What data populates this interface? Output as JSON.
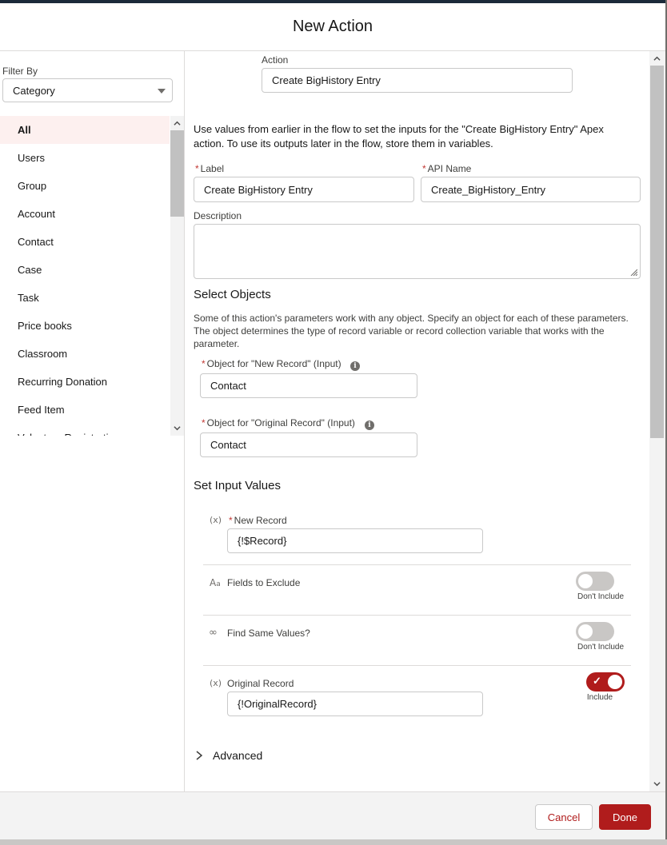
{
  "modal": {
    "title": "New Action"
  },
  "filter": {
    "label": "Filter By",
    "selected": "Category"
  },
  "categories": [
    "All",
    "Users",
    "Group",
    "Account",
    "Contact",
    "Case",
    "Task",
    "Price books",
    "Classroom",
    "Recurring Donation",
    "Feed Item",
    "Volunteer Registration"
  ],
  "action": {
    "label": "Action",
    "value": "Create BigHistory Entry"
  },
  "intro_text": "Use values from earlier in the flow to set the inputs for the \"Create BigHistory Entry\" Apex action. To use its outputs later in the flow, store them in variables.",
  "fields": {
    "label_label": "Label",
    "label_value": "Create BigHistory Entry",
    "api_label": "API Name",
    "api_value": "Create_BigHistory_Entry",
    "description_label": "Description"
  },
  "select_objects": {
    "title": "Select Objects",
    "help": "Some of this action's parameters work with any object. Specify an object for each of these parameters. The object determines the type of record variable or record collection variable that works with the parameter.",
    "new_record_label": "Object for \"New Record\" (Input)",
    "new_record_value": "Contact",
    "original_record_label": "Object for \"Original Record\" (Input)",
    "original_record_value": "Contact"
  },
  "inputs": {
    "title": "Set Input Values",
    "new_record_label": "New Record",
    "new_record_value": "{!$Record}",
    "fields_exclude_label": "Fields to Exclude",
    "fields_exclude_toggle": "Don't Include",
    "find_same_label": "Find Same Values?",
    "find_same_toggle": "Don't Include",
    "original_record_label": "Original Record",
    "original_record_value": "{!OriginalRecord}",
    "original_record_toggle": "Include"
  },
  "advanced": {
    "label": "Advanced"
  },
  "footer": {
    "cancel": "Cancel",
    "done": "Done"
  },
  "icons": {
    "variable": "(x)",
    "text": "A",
    "boolean": "∞",
    "info": "i",
    "chevron_right": "›",
    "check": "✓"
  },
  "colors": {
    "brand": "#b01c1c",
    "active_bg": "#fdf0ef",
    "required": "#c23934"
  }
}
